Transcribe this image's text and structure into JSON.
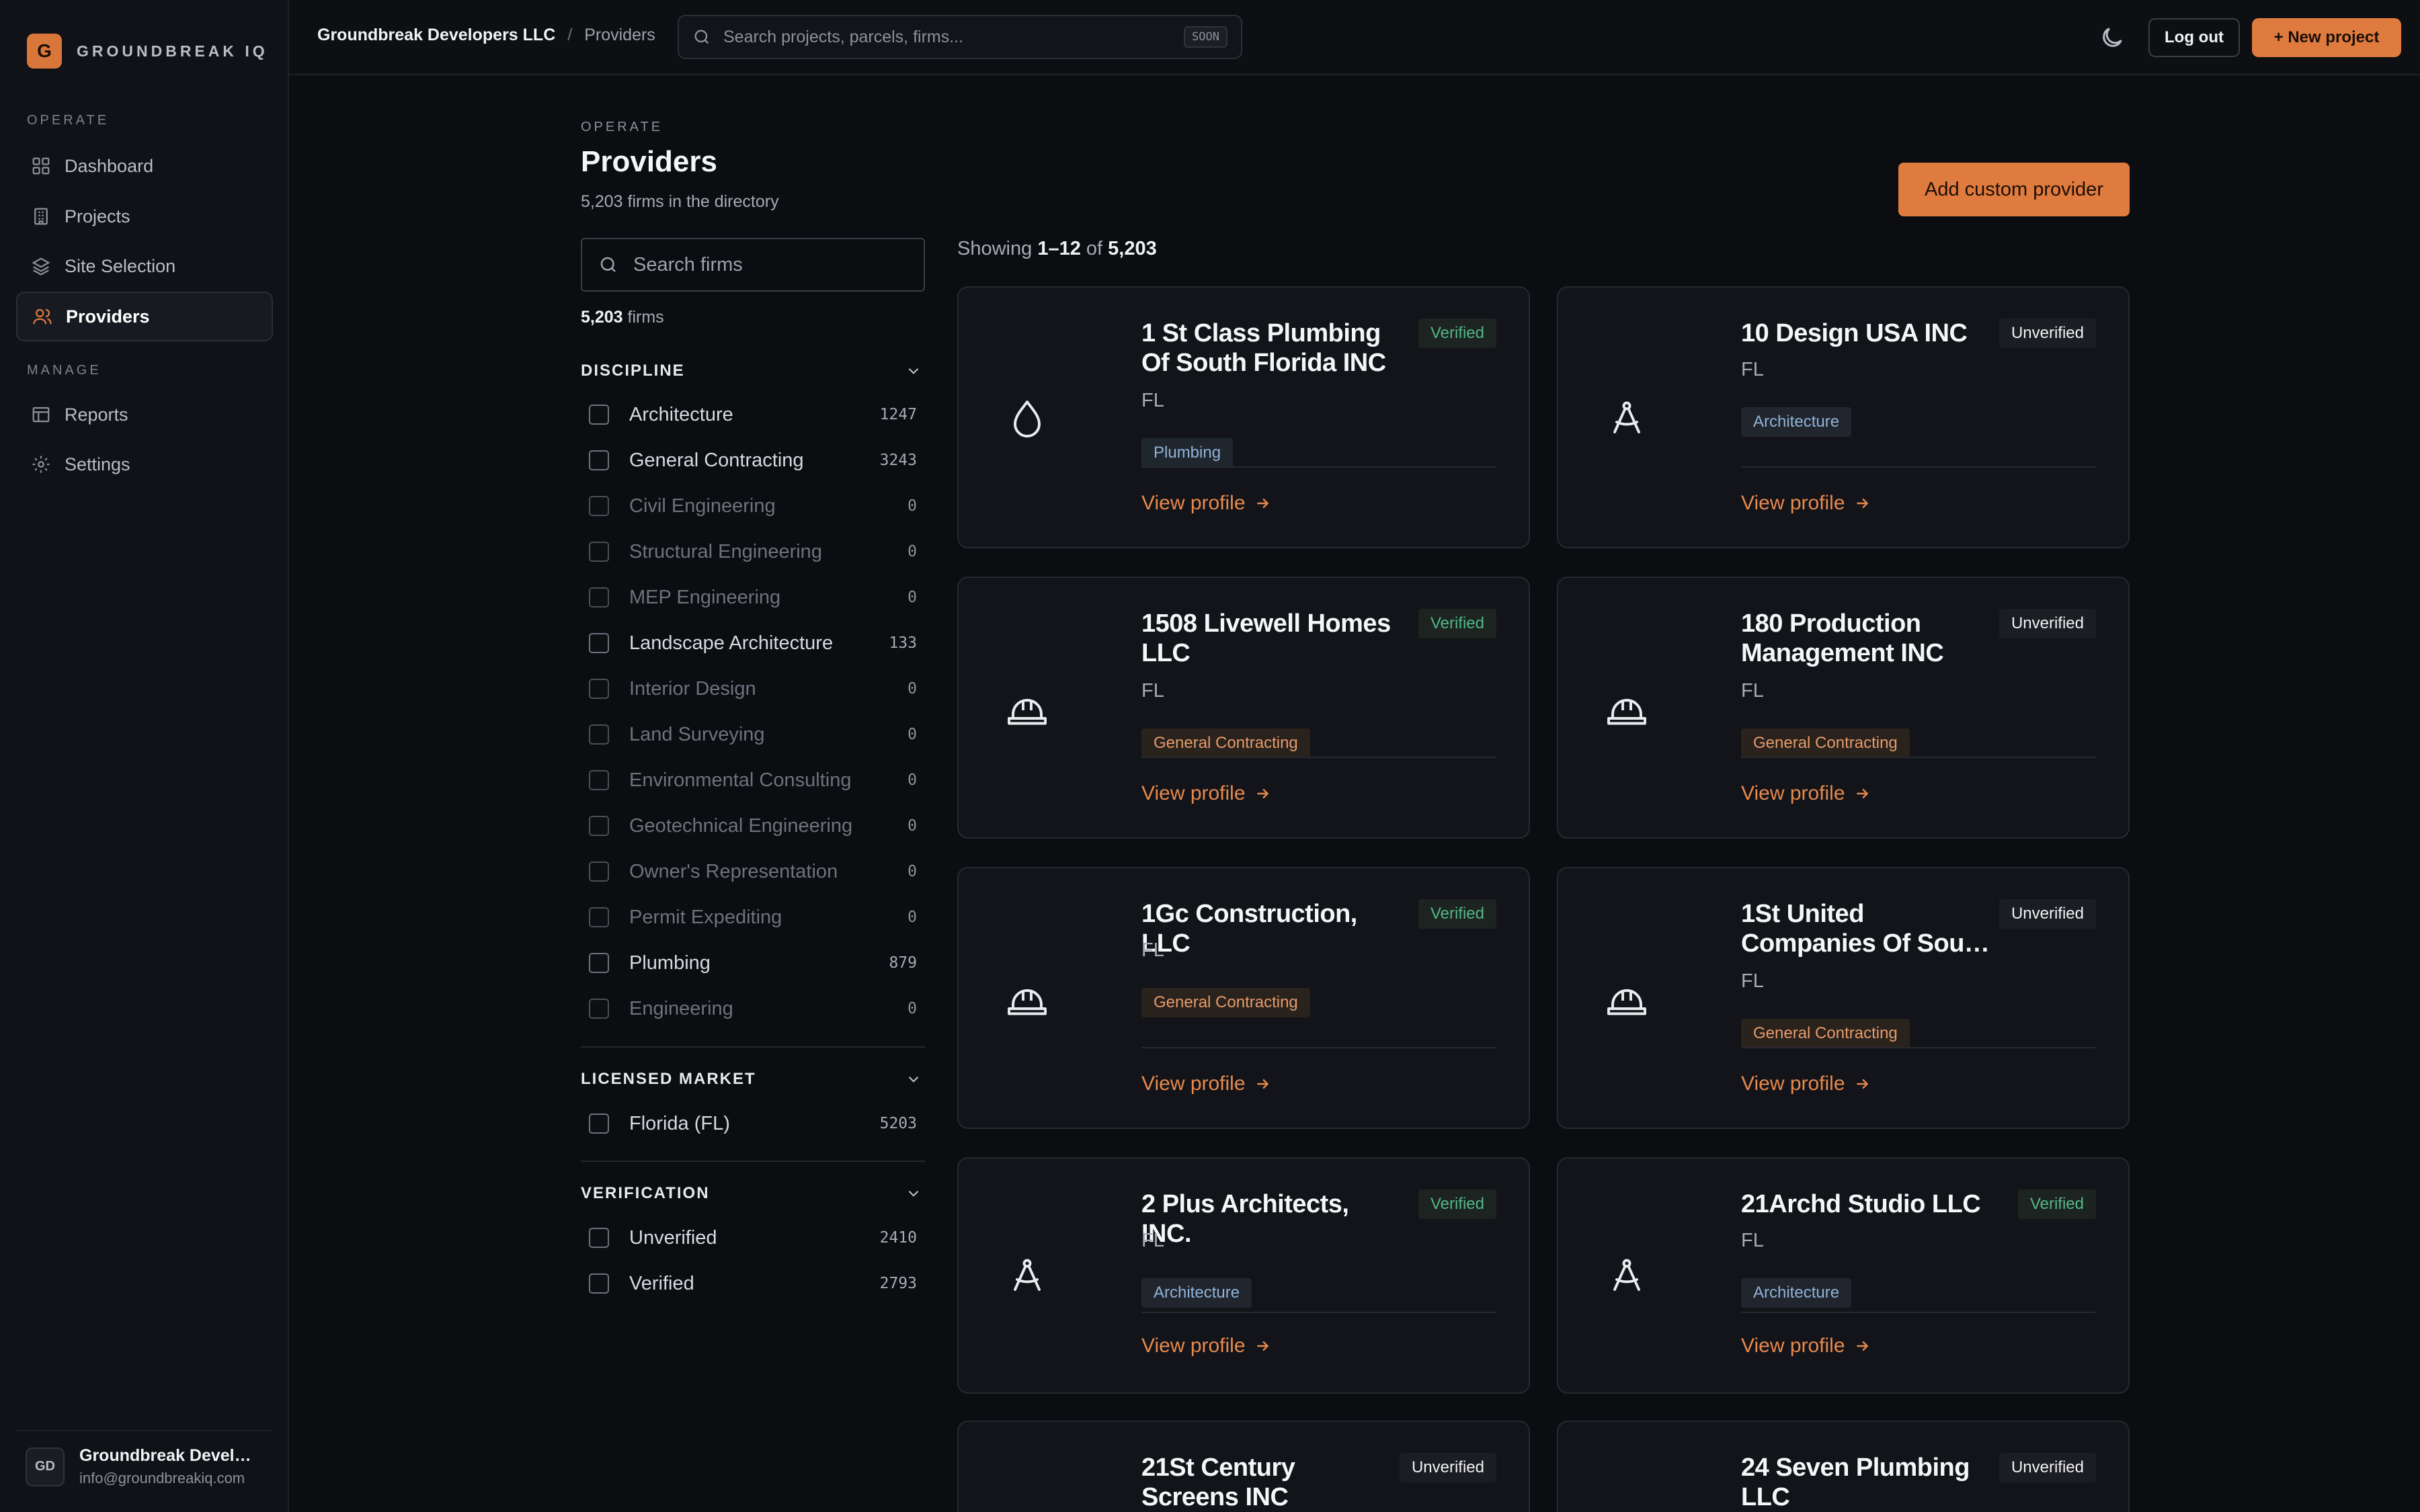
{
  "brand": {
    "logo_letter": "G",
    "name": "GROUNDBREAK IQ"
  },
  "nav": {
    "operate_label": "OPERATE",
    "manage_label": "MANAGE",
    "dashboard": "Dashboard",
    "projects": "Projects",
    "site_selection": "Site Selection",
    "providers": "Providers",
    "reports": "Reports",
    "settings": "Settings"
  },
  "user": {
    "initials": "GD",
    "name": "Groundbreak Developers LLC",
    "email": "info@groundbreakiq.com"
  },
  "topbar": {
    "org": "Groundbreak Developers LLC",
    "sep": "/",
    "page": "Providers",
    "search_placeholder": "Search projects, parcels, firms...",
    "search_badge": "SOON",
    "logout": "Log out",
    "new_project": "+ New project"
  },
  "header": {
    "eyebrow": "OPERATE",
    "title": "Providers",
    "subtitle": "5,203 firms in the directory",
    "add_button": "Add custom provider"
  },
  "filters": {
    "search_placeholder": "Search firms",
    "count_value": "5,203",
    "count_label": "firms",
    "discipline": {
      "title": "DISCIPLINE",
      "items": [
        {
          "label": "Architecture",
          "count": "1247"
        },
        {
          "label": "General Contracting",
          "count": "3243"
        },
        {
          "label": "Civil Engineering",
          "count": "0"
        },
        {
          "label": "Structural Engineering",
          "count": "0"
        },
        {
          "label": "MEP Engineering",
          "count": "0"
        },
        {
          "label": "Landscape Architecture",
          "count": "133"
        },
        {
          "label": "Interior Design",
          "count": "0"
        },
        {
          "label": "Land Surveying",
          "count": "0"
        },
        {
          "label": "Environmental Consulting",
          "count": "0"
        },
        {
          "label": "Geotechnical Engineering",
          "count": "0"
        },
        {
          "label": "Owner's Representation",
          "count": "0"
        },
        {
          "label": "Permit Expediting",
          "count": "0"
        },
        {
          "label": "Plumbing",
          "count": "879"
        },
        {
          "label": "Engineering",
          "count": "0"
        }
      ]
    },
    "market": {
      "title": "LICENSED MARKET",
      "items": [
        {
          "label": "Florida (FL)",
          "count": "5203"
        }
      ]
    },
    "verification": {
      "title": "VERIFICATION",
      "items": [
        {
          "label": "Unverified",
          "count": "2410"
        },
        {
          "label": "Verified",
          "count": "2793"
        }
      ]
    }
  },
  "results": {
    "showing_prefix": "Showing",
    "range": "1–12",
    "of": "of",
    "total": "5,203",
    "view_profile": "View profile",
    "cards": [
      {
        "name": "1 St Class Plumbing Of South Florida INC",
        "badge": "Verified",
        "state": "FL",
        "tag": "Plumbing",
        "icon": "droplet-icon"
      },
      {
        "name": "10 Design USA INC",
        "badge": "Unverified",
        "state": "FL",
        "tag": "Architecture",
        "icon": "compass-icon"
      },
      {
        "name": "1508 Livewell Homes LLC",
        "badge": "Verified",
        "state": "FL",
        "tag": "General Contracting",
        "icon": "hard-hat-icon"
      },
      {
        "name": "180 Production Management INC",
        "badge": "Unverified",
        "state": "FL",
        "tag": "General Contracting",
        "icon": "hard-hat-icon"
      },
      {
        "name": "1Gc Construction, LLC",
        "badge": "Verified",
        "state": "FL",
        "tag": "General Contracting",
        "icon": "hard-hat-icon"
      },
      {
        "name": "1St United Companies Of Sou…",
        "badge": "Unverified",
        "state": "FL",
        "tag": "General Contracting",
        "icon": "hard-hat-icon"
      },
      {
        "name": "2 Plus Architects, INC.",
        "badge": "Verified",
        "state": "FL",
        "tag": "Architecture",
        "icon": "compass-icon"
      },
      {
        "name": "21Archd Studio LLC",
        "badge": "Verified",
        "state": "FL",
        "tag": "Architecture",
        "icon": "compass-icon"
      },
      {
        "name": "21St Century Screens INC",
        "badge": "Unverified"
      },
      {
        "name": "24 Seven Plumbing LLC",
        "badge": "Unverified"
      }
    ]
  },
  "colors": {
    "accent": "#e07b3f",
    "background": "#0b0d11",
    "verified": "#52b788",
    "architecture_tag": "#8fb3d8",
    "contracting_tag": "#e59b6a"
  }
}
